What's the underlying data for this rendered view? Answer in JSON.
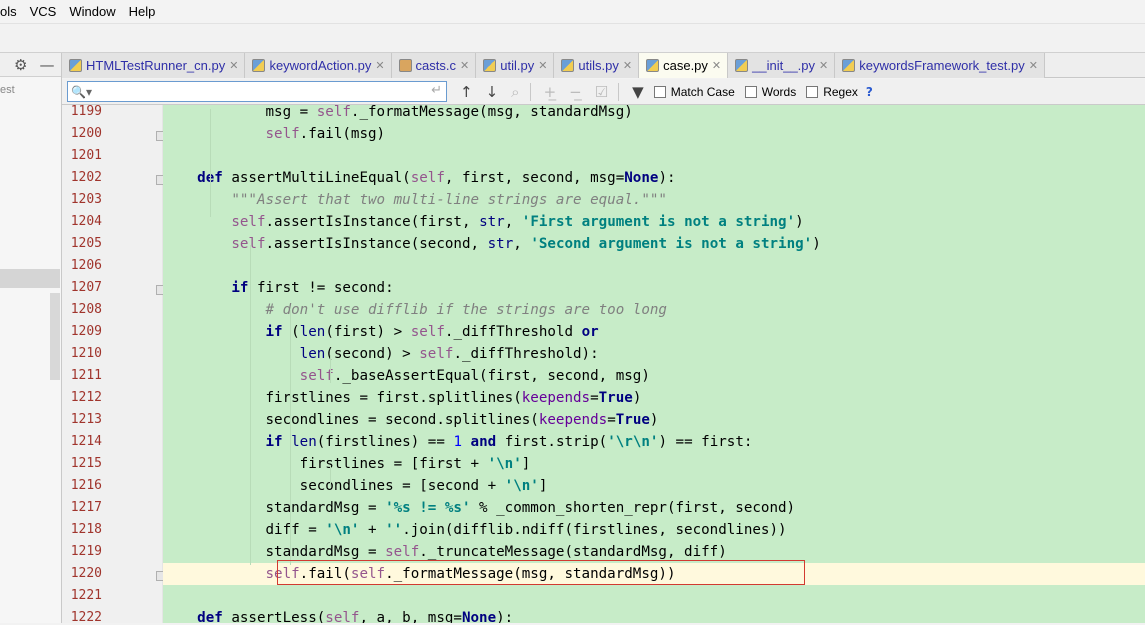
{
  "menubar": {
    "items": [
      "ols",
      "VCS",
      "Window",
      "Help"
    ]
  },
  "leftpanel": {
    "text": "est"
  },
  "tabs": [
    {
      "label": "HTMLTestRunner_cn.py",
      "type": "py"
    },
    {
      "label": "keywordAction.py",
      "type": "py"
    },
    {
      "label": "casts.c",
      "type": "c"
    },
    {
      "label": "util.py",
      "type": "py"
    },
    {
      "label": "utils.py",
      "type": "py"
    },
    {
      "label": "case.py",
      "type": "py",
      "active": true
    },
    {
      "label": "__init__.py",
      "type": "py"
    },
    {
      "label": "keywordsFramework_test.py",
      "type": "py"
    }
  ],
  "find": {
    "value": "",
    "match_case": "Match Case",
    "words": "Words",
    "regex": "Regex",
    "help": "?"
  },
  "lines": [
    {
      "n": "1199",
      "tokens": [
        [
          "",
          "            msg = "
        ],
        [
          "self",
          "self"
        ],
        [
          "",
          "._formatMessage(msg, standardMsg)"
        ]
      ]
    },
    {
      "n": "1200",
      "tokens": [
        [
          "",
          "            "
        ],
        [
          "self",
          "self"
        ],
        [
          "",
          ".fail(msg)"
        ]
      ]
    },
    {
      "n": "1201",
      "tokens": []
    },
    {
      "n": "1202",
      "tokens": [
        [
          "",
          "    "
        ],
        [
          "kw",
          "def"
        ],
        [
          "",
          " assertMultiLineEqual("
        ],
        [
          "self",
          "self"
        ],
        [
          "",
          ", first, second, msg="
        ],
        [
          "kw",
          "None"
        ],
        [
          "",
          "):"
        ]
      ]
    },
    {
      "n": "1203",
      "tokens": [
        [
          "",
          "        "
        ],
        [
          "cmt",
          "\"\"\"Assert that two multi-line strings are equal.\"\"\""
        ]
      ]
    },
    {
      "n": "1204",
      "tokens": [
        [
          "",
          "        "
        ],
        [
          "self",
          "self"
        ],
        [
          "",
          ".assertIsInstance(first, "
        ],
        [
          "bi",
          "str"
        ],
        [
          "",
          ", "
        ],
        [
          "str",
          "'First argument is not a string'"
        ],
        [
          "",
          ")"
        ]
      ]
    },
    {
      "n": "1205",
      "tokens": [
        [
          "",
          "        "
        ],
        [
          "self",
          "self"
        ],
        [
          "",
          ".assertIsInstance(second, "
        ],
        [
          "bi",
          "str"
        ],
        [
          "",
          ", "
        ],
        [
          "str",
          "'Second argument is not a string'"
        ],
        [
          "",
          ")"
        ]
      ]
    },
    {
      "n": "1206",
      "tokens": []
    },
    {
      "n": "1207",
      "tokens": [
        [
          "",
          "        "
        ],
        [
          "kw",
          "if"
        ],
        [
          "",
          " first != second:"
        ]
      ]
    },
    {
      "n": "1208",
      "tokens": [
        [
          "",
          "            "
        ],
        [
          "cmt",
          "# don't use difflib if the strings are too long"
        ]
      ]
    },
    {
      "n": "1209",
      "tokens": [
        [
          "",
          "            "
        ],
        [
          "kw",
          "if"
        ],
        [
          "",
          " ("
        ],
        [
          "bi",
          "len"
        ],
        [
          "",
          "(first) > "
        ],
        [
          "self",
          "self"
        ],
        [
          "",
          "._diffThreshold "
        ],
        [
          "kw",
          "or"
        ]
      ]
    },
    {
      "n": "1210",
      "tokens": [
        [
          "",
          "                "
        ],
        [
          "bi",
          "len"
        ],
        [
          "",
          "(second) > "
        ],
        [
          "self",
          "self"
        ],
        [
          "",
          "._diffThreshold):"
        ]
      ]
    },
    {
      "n": "1211",
      "tokens": [
        [
          "",
          "                "
        ],
        [
          "self",
          "self"
        ],
        [
          "",
          "._baseAssertEqual(first, second, msg)"
        ]
      ]
    },
    {
      "n": "1212",
      "tokens": [
        [
          "",
          "            firstlines = first.splitlines("
        ],
        [
          "kwa",
          "keepends"
        ],
        [
          "",
          "="
        ],
        [
          "kw",
          "True"
        ],
        [
          "",
          ")"
        ]
      ]
    },
    {
      "n": "1213",
      "tokens": [
        [
          "",
          "            secondlines = second.splitlines("
        ],
        [
          "kwa",
          "keepends"
        ],
        [
          "",
          "="
        ],
        [
          "kw",
          "True"
        ],
        [
          "",
          ")"
        ]
      ]
    },
    {
      "n": "1214",
      "tokens": [
        [
          "",
          "            "
        ],
        [
          "kw",
          "if"
        ],
        [
          "",
          " "
        ],
        [
          "bi",
          "len"
        ],
        [
          "",
          "(firstlines) == "
        ],
        [
          "num",
          "1"
        ],
        [
          "",
          " "
        ],
        [
          "kw",
          "and"
        ],
        [
          "",
          " first.strip("
        ],
        [
          "str",
          "'\\r\\n'"
        ],
        [
          "",
          ") == first:"
        ]
      ]
    },
    {
      "n": "1215",
      "tokens": [
        [
          "",
          "                firstlines = [first + "
        ],
        [
          "str",
          "'\\n'"
        ],
        [
          "",
          "]"
        ]
      ]
    },
    {
      "n": "1216",
      "tokens": [
        [
          "",
          "                secondlines = [second + "
        ],
        [
          "str",
          "'\\n'"
        ],
        [
          "",
          "]"
        ]
      ]
    },
    {
      "n": "1217",
      "tokens": [
        [
          "",
          "            standardMsg = "
        ],
        [
          "str",
          "'%s != %s'"
        ],
        [
          "",
          " % _common_shorten_repr(first, second)"
        ]
      ]
    },
    {
      "n": "1218",
      "tokens": [
        [
          "",
          "            diff = "
        ],
        [
          "str",
          "'\\n'"
        ],
        [
          "",
          " + "
        ],
        [
          "str",
          "''"
        ],
        [
          "",
          ".join(difflib.ndiff(firstlines, secondlines))"
        ]
      ]
    },
    {
      "n": "1219",
      "tokens": [
        [
          "",
          "            standardMsg = "
        ],
        [
          "self",
          "self"
        ],
        [
          "",
          "._truncateMessage(standardMsg, diff)"
        ]
      ]
    },
    {
      "n": "1220",
      "tokens": [
        [
          "",
          "            "
        ],
        [
          "self",
          "self"
        ],
        [
          "",
          ".fail("
        ],
        [
          "self",
          "self"
        ],
        [
          "",
          "._formatMessage(msg, standardMsg))"
        ]
      ],
      "current": true
    },
    {
      "n": "1221",
      "tokens": []
    },
    {
      "n": "1222",
      "tokens": [
        [
          "",
          "    "
        ],
        [
          "kw",
          "def"
        ],
        [
          "",
          " assertLess("
        ],
        [
          "self",
          "self"
        ],
        [
          "",
          ", a, b, msg="
        ],
        [
          "kw",
          "None"
        ],
        [
          "",
          "):"
        ]
      ]
    }
  ],
  "colors": {
    "editor_bg": "#c7ecc8",
    "current_line": "#fff9dd",
    "keyword": "#000080",
    "self": "#94558d",
    "string": "#008080",
    "highlight_box": "#d23a30"
  }
}
